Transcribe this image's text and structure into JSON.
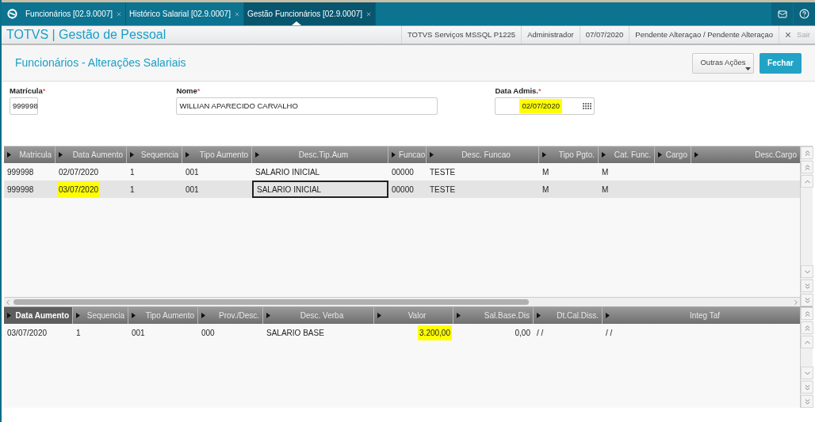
{
  "tabs": [
    {
      "label": "Funcionários [02.9.0007]",
      "selected": false
    },
    {
      "label": "Histórico Salarial [02.9.0007]",
      "selected": false
    },
    {
      "label": "Gestão Funcionários [02.9.0007]",
      "selected": true
    }
  ],
  "header": {
    "app_title": "TOTVS | Gestão de Pessoal",
    "info": [
      "TOTVS Serviços MSSQL P1225",
      "Administrador",
      "07/07/2020",
      "Pendente Alteraçao / Pendente Alteraçao"
    ],
    "exit_label": "Sair"
  },
  "page_title": "Funcionários - Alterações Salariais",
  "actions": [
    {
      "label": "Outras Ações",
      "kind": "menu"
    },
    {
      "label": "Fechar",
      "kind": "primary"
    }
  ],
  "form": {
    "fields": [
      {
        "label": "Matrícula",
        "required_mark": "*",
        "value": "999998",
        "kind": "text",
        "highlighted": false
      },
      {
        "label": "Nome",
        "required_mark": "*",
        "value": "WILLIAN APARECIDO CARVALHO",
        "kind": "text",
        "highlighted": false
      },
      {
        "label": "Data Admis.",
        "required_mark": "*",
        "value": "02/07/2020",
        "kind": "date",
        "highlighted": true
      }
    ]
  },
  "top_grid": {
    "columns": [
      {
        "label": "Matricula",
        "sorted": false
      },
      {
        "label": "Data Aumento",
        "sorted": false
      },
      {
        "label": "Sequencia",
        "sorted": false
      },
      {
        "label": "Tipo Aumento",
        "sorted": false
      },
      {
        "label": "Desc.Tip.Aum",
        "sorted": false
      },
      {
        "label": "Funcao",
        "sorted": false
      },
      {
        "label": "Desc. Funcao",
        "sorted": false
      },
      {
        "label": "Tipo Pgto.",
        "sorted": false
      },
      {
        "label": "Cat. Func.",
        "sorted": false
      },
      {
        "label": "Cargo",
        "sorted": false
      },
      {
        "label": "Desc.Cargo",
        "sorted": false
      }
    ],
    "rows": [
      {
        "selected": false,
        "cells": [
          {
            "text": "999998",
            "highlighted": false,
            "focused": false
          },
          {
            "text": "02/07/2020",
            "highlighted": false,
            "focused": false
          },
          {
            "text": "1",
            "highlighted": false,
            "focused": false
          },
          {
            "text": "001",
            "highlighted": false,
            "focused": false
          },
          {
            "text": "SALARIO INICIAL",
            "highlighted": false,
            "focused": false
          },
          {
            "text": "00000",
            "highlighted": false,
            "focused": false
          },
          {
            "text": "TESTE",
            "highlighted": false,
            "focused": false
          },
          {
            "text": "M",
            "highlighted": false,
            "focused": false
          },
          {
            "text": "M",
            "highlighted": false,
            "focused": false
          }
        ]
      },
      {
        "selected": true,
        "cells": [
          {
            "text": "999998",
            "highlighted": false,
            "focused": false
          },
          {
            "text": "03/07/2020",
            "highlighted": true,
            "focused": false
          },
          {
            "text": "1",
            "highlighted": false,
            "focused": false
          },
          {
            "text": "001",
            "highlighted": false,
            "focused": false
          },
          {
            "text": "SALARIO INICIAL",
            "highlighted": false,
            "focused": true
          },
          {
            "text": "00000",
            "highlighted": false,
            "focused": false
          },
          {
            "text": "TESTE",
            "highlighted": false,
            "focused": false
          },
          {
            "text": "M",
            "highlighted": false,
            "focused": false
          },
          {
            "text": "M",
            "highlighted": false,
            "focused": false
          }
        ]
      }
    ]
  },
  "bottom_grid": {
    "columns": [
      {
        "label": "Data Aumento",
        "sorted": true
      },
      {
        "label": "Sequencia",
        "sorted": false
      },
      {
        "label": "Tipo Aumento",
        "sorted": false
      },
      {
        "label": "Prov./Desc.",
        "sorted": false
      },
      {
        "label": "Desc. Verba",
        "sorted": false
      },
      {
        "label": "Valor",
        "sorted": false
      },
      {
        "label": "Sal.Base.Dis",
        "sorted": false
      },
      {
        "label": "Dt.Cal.Diss.",
        "sorted": false
      },
      {
        "label": "Integ Taf",
        "sorted": false
      }
    ],
    "rows": [
      {
        "selected": false,
        "cells": [
          {
            "text": "03/07/2020",
            "highlighted": false,
            "focused": false
          },
          {
            "text": "1",
            "highlighted": false,
            "focused": false
          },
          {
            "text": "001",
            "highlighted": false,
            "focused": false
          },
          {
            "text": "000",
            "highlighted": false,
            "focused": false
          },
          {
            "text": "SALARIO BASE",
            "highlighted": false,
            "focused": false
          },
          {
            "text": "3.200,00",
            "highlighted": true,
            "focused": false
          },
          {
            "text": "0,00",
            "highlighted": false,
            "focused": false
          },
          {
            "text": "/ /",
            "highlighted": false,
            "focused": false
          },
          {
            "text": "/ /",
            "highlighted": false,
            "focused": false
          }
        ]
      }
    ]
  }
}
